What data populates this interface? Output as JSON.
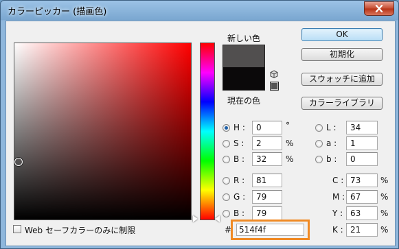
{
  "window": {
    "title": "カラーピッカー (描画色)"
  },
  "swatches": {
    "new_label": "新しい色",
    "current_label": "現在の色",
    "new_color": "#514f4f",
    "current_color": "#0b090a"
  },
  "buttons": {
    "ok": "OK",
    "reset": "初期化",
    "add_swatch": "スウォッチに追加",
    "color_library": "カラーライブラリ"
  },
  "hsb": [
    {
      "label": "H :",
      "value": "0",
      "unit": "°",
      "selected": true
    },
    {
      "label": "S :",
      "value": "2",
      "unit": "%",
      "selected": false
    },
    {
      "label": "B :",
      "value": "32",
      "unit": "%",
      "selected": false
    }
  ],
  "rgb": [
    {
      "label": "R :",
      "value": "81"
    },
    {
      "label": "G :",
      "value": "79"
    },
    {
      "label": "B :",
      "value": "79"
    }
  ],
  "lab": [
    {
      "label": "L :",
      "value": "34"
    },
    {
      "label": "a :",
      "value": "1"
    },
    {
      "label": "b :",
      "value": "0"
    }
  ],
  "cmyk": [
    {
      "label": "C :",
      "value": "73",
      "unit": "%"
    },
    {
      "label": "M :",
      "value": "67",
      "unit": "%"
    },
    {
      "label": "Y :",
      "value": "63",
      "unit": "%"
    },
    {
      "label": "K :",
      "value": "21",
      "unit": "%"
    }
  ],
  "hex": {
    "label": "#",
    "value": "514f4f"
  },
  "websafe": {
    "label": "Web セーフカラーのみに制限",
    "checked": false
  },
  "colors": {
    "highlight": "#f08a24",
    "hue": "#ff0000"
  }
}
